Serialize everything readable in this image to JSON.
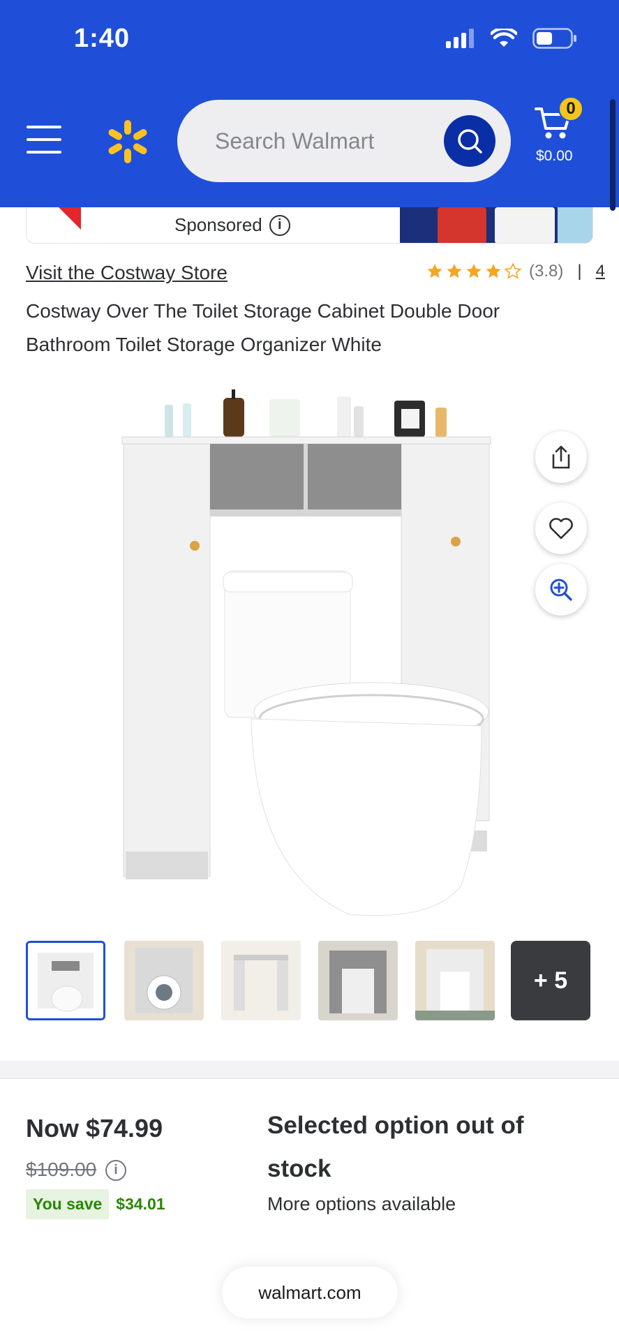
{
  "status_bar": {
    "time": "1:40"
  },
  "header": {
    "search": {
      "placeholder": "Search Walmart"
    },
    "cart": {
      "count": "0",
      "total": "$0.00"
    }
  },
  "sponsored": {
    "label": "Sponsored",
    "info_icon": "i"
  },
  "product": {
    "store_link": "Visit the Costway Store",
    "rating": {
      "stars": 3.8,
      "display": "(3.8)",
      "divider": "|",
      "review_count": "4"
    },
    "title": "Costway Over The Toilet Storage Cabinet Double Door Bathroom Toilet Storage Organizer White"
  },
  "thumbnails": {
    "more_label": "+ 5"
  },
  "pricing": {
    "now": "Now $74.99",
    "was": "$109.00",
    "info_icon": "i",
    "you_save_label": "You save",
    "save_amount": "$34.01"
  },
  "stock": {
    "title": "Selected option out of stock",
    "subtitle": "More options available"
  },
  "browser": {
    "url": "walmart.com"
  },
  "colors": {
    "brand_blue": "#1f4fd8",
    "spark_yellow": "#ffc220",
    "star_gold": "#f5a623",
    "save_green": "#2a8703"
  }
}
